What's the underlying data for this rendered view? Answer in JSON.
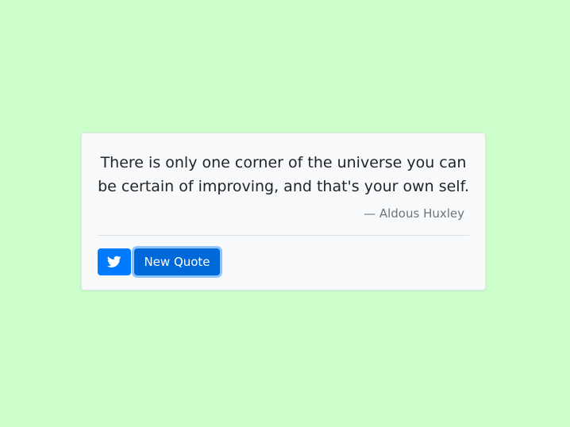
{
  "quote": {
    "text": "There is only one corner of the universe you can be certain of improving, and that's your own self.",
    "author": "— Aldous Huxley"
  },
  "actions": {
    "tweet_icon": "twitter-icon",
    "new_quote_label": "New Quote"
  },
  "colors": {
    "background": "#ccffcc",
    "card": "#f8f9fa",
    "primary": "#007bff"
  }
}
